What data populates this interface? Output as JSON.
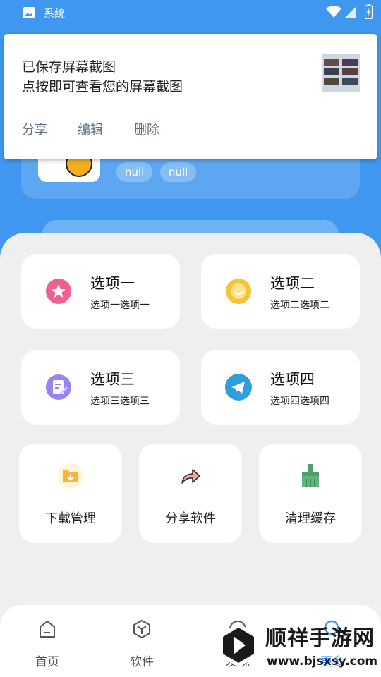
{
  "status_bar": {
    "system_label": "系统"
  },
  "notification": {
    "line1": "已保存屏幕截图",
    "line2": "点按即可查看您的屏幕截图",
    "actions": {
      "share": "分享",
      "edit": "编辑",
      "delete": "删除"
    }
  },
  "profile": {
    "tags": [
      "null",
      "null"
    ]
  },
  "options": [
    {
      "title": "选项一",
      "subtitle": "选项一选项一",
      "icon": "pink-star-icon",
      "color": "#f05f92"
    },
    {
      "title": "选项二",
      "subtitle": "选项二选项二",
      "icon": "yellow-smile-icon",
      "color": "#f7c233"
    },
    {
      "title": "选项三",
      "subtitle": "选项三选项三",
      "icon": "purple-note-icon",
      "color": "#9b82f0"
    },
    {
      "title": "选项四",
      "subtitle": "选项四选项四",
      "icon": "telegram-send-icon",
      "color": "#2e9fdc"
    }
  ],
  "tools": [
    {
      "label": "下载管理",
      "icon": "download-folder-icon"
    },
    {
      "label": "分享软件",
      "icon": "share-arrow-icon"
    },
    {
      "label": "清理缓存",
      "icon": "broom-icon"
    }
  ],
  "bottom_nav": [
    {
      "label": "首页",
      "icon": "home-icon"
    },
    {
      "label": "软件",
      "icon": "cube-icon"
    },
    {
      "label": "发现",
      "icon": "compass-icon"
    },
    {
      "label": "更多",
      "icon": "search-icon"
    }
  ],
  "watermark": {
    "title": "顺祥手游网",
    "url": "www.bjsxsy.com"
  },
  "colors": {
    "accent": "#3f97f0",
    "sheet": "#efefef"
  }
}
